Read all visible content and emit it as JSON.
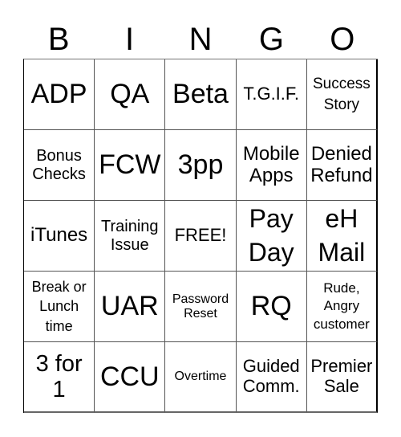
{
  "header": {
    "letters": [
      "B",
      "I",
      "N",
      "G",
      "O"
    ]
  },
  "cells": [
    "ADP",
    "QA",
    "Beta",
    "T.G.I.F.",
    "Success\nStory",
    "Bonus\nChecks",
    "FCW",
    "3pp",
    "Mobile\nApps",
    "Denied\nRefund",
    "iTunes",
    "Training\nIssue",
    "FREE!",
    "Pay\nDay",
    "eH\nMail",
    "Break or\nLunch\ntime",
    "UAR",
    "Password\nReset",
    "RQ",
    "Rude,\nAngry\ncustomer",
    "3 for\n1",
    "CCU",
    "Overtime",
    "Guided\nComm.",
    "Premier\nSale"
  ]
}
